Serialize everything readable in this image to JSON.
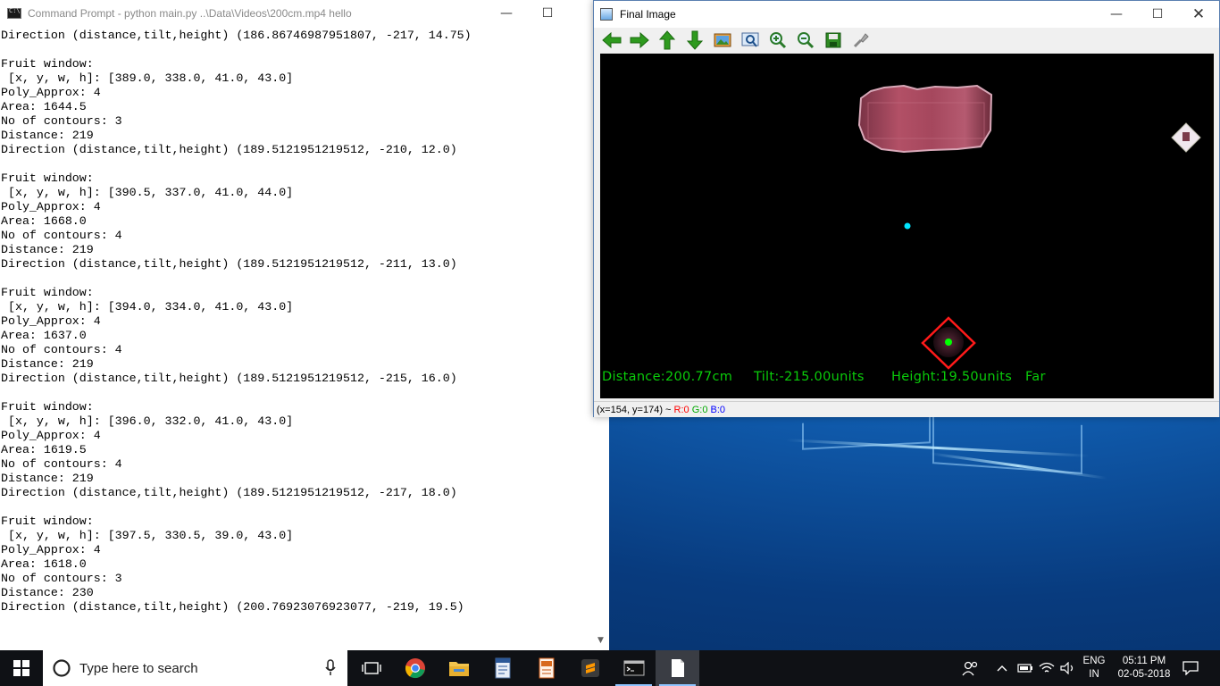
{
  "cmd": {
    "title": "Command Prompt - python  main.py ..\\Data\\Videos\\200cm.mp4 hello",
    "lines": [
      "Direction (distance,tilt,height) (186.86746987951807, -217, 14.75)",
      "",
      "Fruit window:",
      " [x, y, w, h]: [389.0, 338.0, 41.0, 43.0]",
      "Poly_Approx: 4",
      "Area: 1644.5",
      "No of contours: 3",
      "Distance: 219",
      "Direction (distance,tilt,height) (189.5121951219512, -210, 12.0)",
      "",
      "Fruit window:",
      " [x, y, w, h]: [390.5, 337.0, 41.0, 44.0]",
      "Poly_Approx: 4",
      "Area: 1668.0",
      "No of contours: 4",
      "Distance: 219",
      "Direction (distance,tilt,height) (189.5121951219512, -211, 13.0)",
      "",
      "Fruit window:",
      " [x, y, w, h]: [394.0, 334.0, 41.0, 43.0]",
      "Poly_Approx: 4",
      "Area: 1637.0",
      "No of contours: 4",
      "Distance: 219",
      "Direction (distance,tilt,height) (189.5121951219512, -215, 16.0)",
      "",
      "Fruit window:",
      " [x, y, w, h]: [396.0, 332.0, 41.0, 43.0]",
      "Poly_Approx: 4",
      "Area: 1619.5",
      "No of contours: 4",
      "Distance: 219",
      "Direction (distance,tilt,height) (189.5121951219512, -217, 18.0)",
      "",
      "Fruit window:",
      " [x, y, w, h]: [397.5, 330.5, 39.0, 43.0]",
      "Poly_Approx: 4",
      "Area: 1618.0",
      "No of contours: 3",
      "Distance: 230",
      "Direction (distance,tilt,height) (200.76923076923077, -219, 19.5)"
    ]
  },
  "image_window": {
    "title": "Final Image",
    "toolbar": [
      "arrow-left-icon",
      "arrow-right-icon",
      "arrow-up-icon",
      "arrow-down-icon",
      "image-icon",
      "zoom-fit-icon",
      "zoom-in-icon",
      "zoom-out-icon",
      "save-icon",
      "properties-icon"
    ],
    "overlay": {
      "distance": "Distance:200.77cm",
      "tilt": "Tilt:-215.00units",
      "height": "Height:19.50units",
      "status": "Far"
    },
    "status": {
      "coords": "(x=154, y=174) ~",
      "r": "R:0",
      "g": "G:0",
      "b": "B:0"
    }
  },
  "taskbar": {
    "search_placeholder": "Type here to search",
    "language_top": "ENG",
    "language_bottom": "IN",
    "time": "05:11 PM",
    "date": "02-05-2018"
  },
  "colors": {
    "overlay_text": "#0acc0a",
    "marker_red": "#ff0000",
    "marker_center": "#00ff00",
    "cyan_dot": "#00e5ff",
    "status_r": "#ff0000",
    "status_g": "#00aa00",
    "status_b": "#0000ff"
  }
}
